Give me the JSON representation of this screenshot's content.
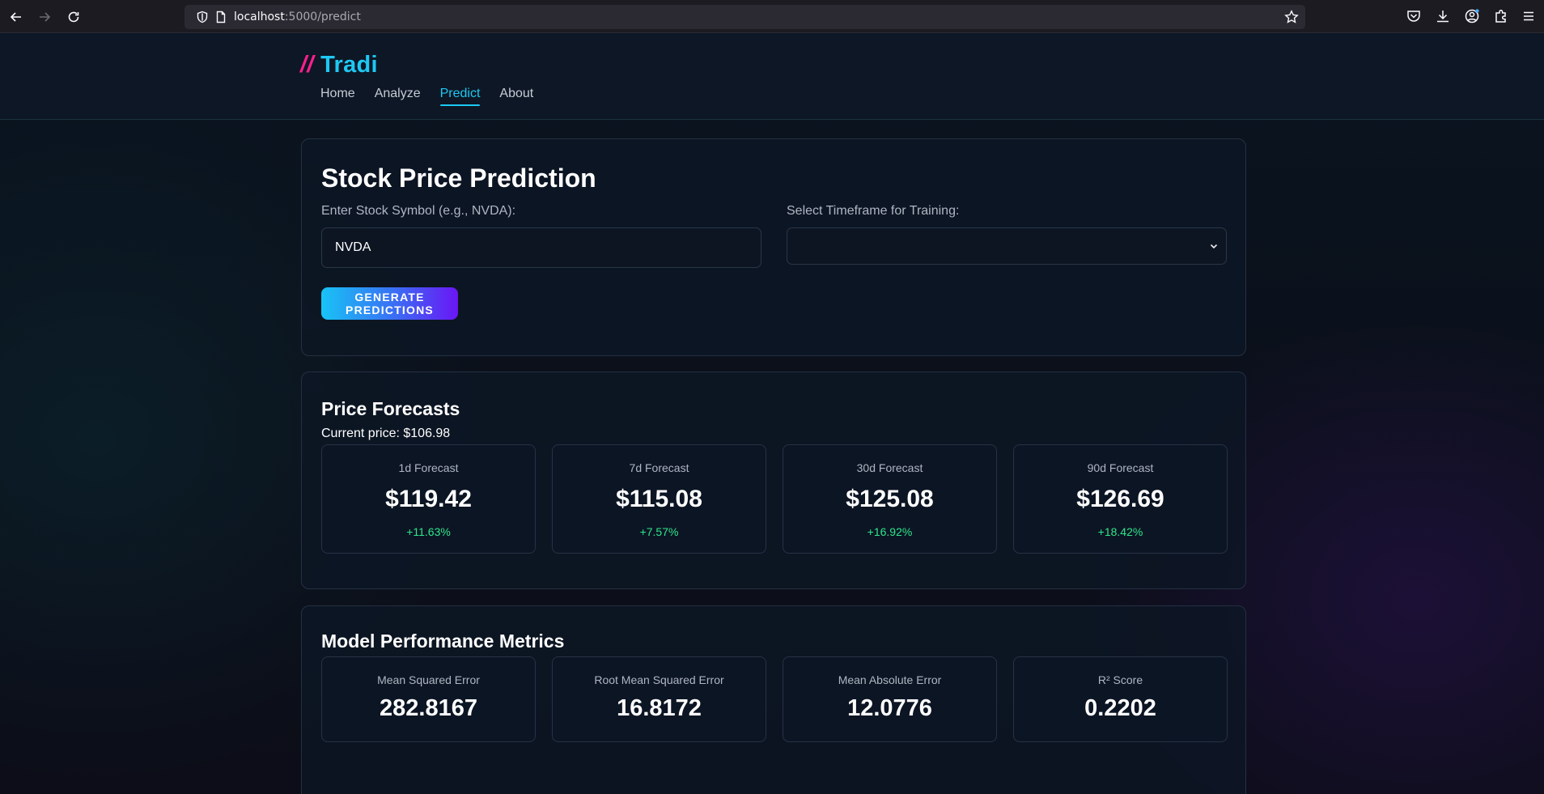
{
  "browser": {
    "url_host": "localhost",
    "url_path": ":5000/predict",
    "icons": [
      "back-icon",
      "forward-icon",
      "reload-icon",
      "shield-icon",
      "page-icon",
      "bookmark-star-icon",
      "pocket-icon",
      "download-icon",
      "account-icon",
      "extensions-icon",
      "menu-icon"
    ]
  },
  "brand": {
    "slashes": "//",
    "name": "Tradi"
  },
  "nav": {
    "items": [
      {
        "label": "Home"
      },
      {
        "label": "Analyze"
      },
      {
        "label": "Predict"
      },
      {
        "label": "About"
      }
    ],
    "active": "Predict"
  },
  "prediction_form": {
    "title": "Stock Price Prediction",
    "symbol_label": "Enter Stock Symbol (e.g., NVDA):",
    "symbol_value": "NVDA",
    "timeframe_label": "Select Timeframe for Training:",
    "timeframe_value": "",
    "button_label": "GENERATE PREDICTIONS"
  },
  "forecasts": {
    "title": "Price Forecasts",
    "current_price": "Current price: $106.98",
    "items": [
      {
        "label": "1d Forecast",
        "value": "$119.42",
        "change": "+11.63%"
      },
      {
        "label": "7d Forecast",
        "value": "$115.08",
        "change": "+7.57%"
      },
      {
        "label": "30d Forecast",
        "value": "$125.08",
        "change": "+16.92%"
      },
      {
        "label": "90d Forecast",
        "value": "$126.69",
        "change": "+18.42%"
      }
    ]
  },
  "metrics": {
    "title": "Model Performance Metrics",
    "items": [
      {
        "label": "Mean Squared Error",
        "value": "282.8167"
      },
      {
        "label": "Root Mean Squared Error",
        "value": "16.8172"
      },
      {
        "label": "Mean Absolute Error",
        "value": "12.0776"
      },
      {
        "label": "R² Score",
        "value": "0.2202"
      }
    ]
  },
  "colors": {
    "accent_cyan": "#1ec8f3",
    "accent_pink": "#ff1f8e",
    "positive_green": "#2ee68a",
    "button_gradient": [
      "#18c3f5",
      "#6a16f5"
    ]
  }
}
